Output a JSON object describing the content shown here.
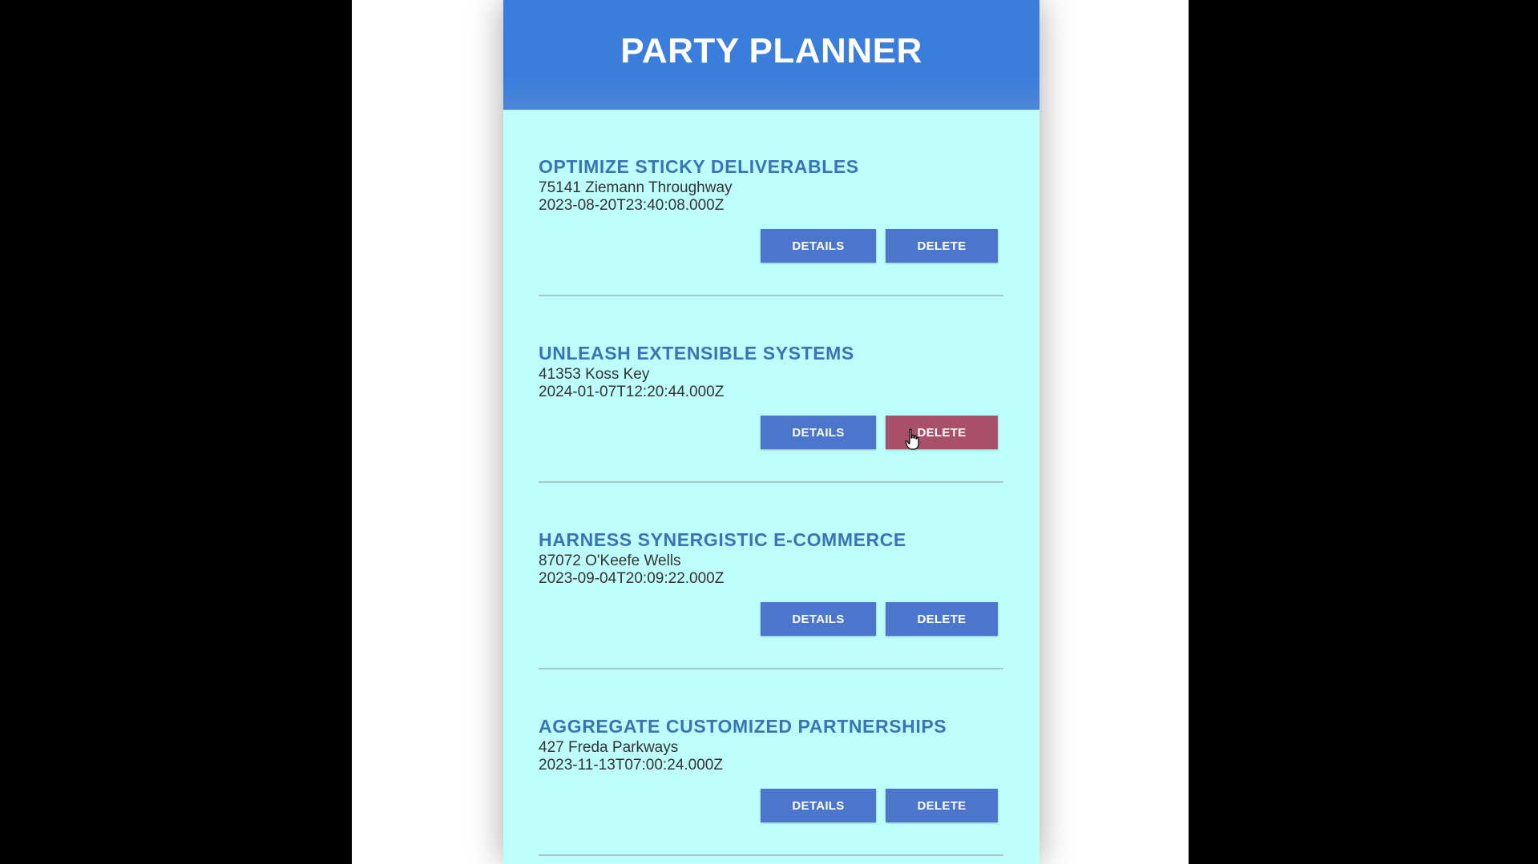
{
  "header": {
    "title": "PARTY PLANNER"
  },
  "parties": [
    {
      "name": "OPTIMIZE STICKY DELIVERABLES",
      "address": "75141 Ziemann Throughway",
      "date": "2023-08-20T23:40:08.000Z",
      "details_label": "DETAILS",
      "delete_label": "DELETE"
    },
    {
      "name": "UNLEASH EXTENSIBLE SYSTEMS",
      "address": "41353 Koss Key",
      "date": "2024-01-07T12:20:44.000Z",
      "details_label": "DETAILS",
      "delete_label": "DELETE"
    },
    {
      "name": "HARNESS SYNERGISTIC E-COMMERCE",
      "address": "87072 O'Keefe Wells",
      "date": "2023-09-04T20:09:22.000Z",
      "details_label": "DETAILS",
      "delete_label": "DELETE"
    },
    {
      "name": "AGGREGATE CUSTOMIZED PARTNERSHIPS",
      "address": "427 Freda Parkways",
      "date": "2023-11-13T07:00:24.000Z",
      "details_label": "DETAILS",
      "delete_label": "DELETE"
    }
  ],
  "colors": {
    "header_bg": "#3b7ddd",
    "app_bg": "#bdfdfc",
    "title_text": "#3b74b6",
    "button_bg": "#4b76cc",
    "delete_hover_bg": "#a94f6a"
  },
  "cursor": {
    "icon": "hand-pointer-icon"
  }
}
